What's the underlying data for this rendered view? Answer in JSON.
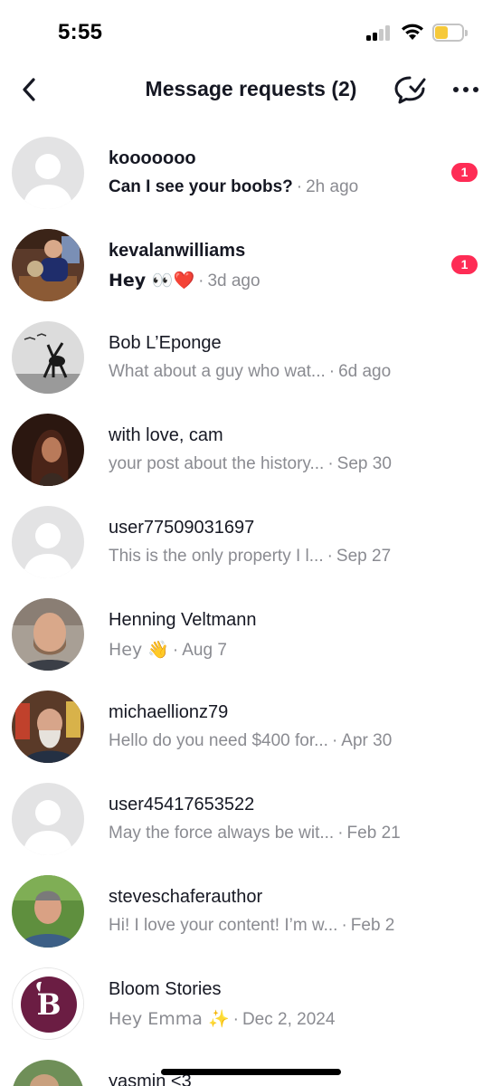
{
  "status_bar": {
    "time": "5:55"
  },
  "header": {
    "title": "Message requests (2)"
  },
  "messages": [
    {
      "name": "kooooooo",
      "preview": "Can I see your boobs?",
      "time": "2h ago",
      "unread": "1",
      "avatar": "default-avatar"
    },
    {
      "name": "kevalanwilliams",
      "preview": "Hey 👀❤️",
      "time": "3d ago",
      "unread": "1",
      "avatar": "photo-avatar"
    },
    {
      "name": "Bob L’Eponge",
      "preview": "What about a guy who wat...",
      "time": "6d ago",
      "avatar": "photo-avatar"
    },
    {
      "name": "with love, cam",
      "preview": "your post about the history...",
      "time": "Sep 30",
      "avatar": "photo-avatar"
    },
    {
      "name": "user77509031697",
      "preview": "This is the only property I l...",
      "time": "Sep 27",
      "avatar": "default-avatar"
    },
    {
      "name": "Henning Veltmann",
      "preview": "Hey 👋",
      "time": "Aug 7",
      "avatar": "photo-avatar"
    },
    {
      "name": "michaellionz79",
      "preview": "Hello do you need $400 for...",
      "time": "Apr 30",
      "avatar": "photo-avatar"
    },
    {
      "name": "user45417653522",
      "preview": "May the force always be wit...",
      "time": "Feb 21",
      "avatar": "default-avatar"
    },
    {
      "name": "steveschaferauthor",
      "preview": "Hi! I love your content! I’m w...",
      "time": "Feb 2",
      "avatar": "photo-avatar"
    },
    {
      "name": "Bloom Stories",
      "preview": "Hey Emma ✨",
      "time": "Dec 2, 2024",
      "avatar": "logo-avatar",
      "logo_letter": "B"
    },
    {
      "name": "yasmin <3",
      "avatar": "photo-avatar"
    }
  ],
  "colors": {
    "badge": "#fe2c55",
    "secondary_text": "#8a8b91",
    "primary_text": "#161823",
    "bloom_brand": "#6b1d43"
  }
}
